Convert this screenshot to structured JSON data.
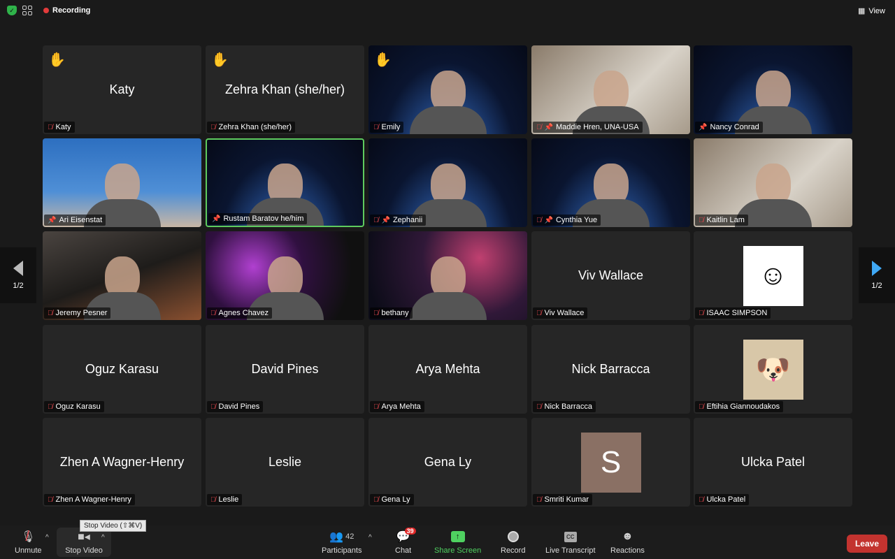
{
  "topbar": {
    "recording": "Recording",
    "view": "View"
  },
  "pager": {
    "left": "1/2",
    "right": "1/2"
  },
  "tiles": [
    {
      "name": "Katy",
      "center": "Katy",
      "hand": true,
      "muted": true
    },
    {
      "name": "Zehra Khan (she/her)",
      "center": "Zehra Khan (she/her)",
      "hand": true,
      "muted": true
    },
    {
      "name": "Emily",
      "hand": true,
      "muted": true,
      "video": "space"
    },
    {
      "name": "Maddie Hren, UNA-USA",
      "muted": true,
      "pinned": true,
      "video": "room"
    },
    {
      "name": "Nancy Conrad",
      "pinned": true,
      "video": "space"
    },
    {
      "name": "Ari Eisenstat",
      "pinned": true,
      "video": "blue"
    },
    {
      "name": "Rustam Baratov he/him",
      "pinned": true,
      "video": "space",
      "active": true
    },
    {
      "name": "Zephanii",
      "muted": true,
      "pinned": true,
      "video": "space"
    },
    {
      "name": "Cynthia Yue",
      "muted": true,
      "pinned": true,
      "video": "space"
    },
    {
      "name": "Kaitlin Lam",
      "muted": true,
      "video": "room"
    },
    {
      "name": "Jeremy Pesner",
      "muted": true,
      "video": "dark"
    },
    {
      "name": "Agnes Chavez",
      "muted": true,
      "video": "neon"
    },
    {
      "name": "bethany",
      "muted": true,
      "video": "nebula"
    },
    {
      "name": "Viv Wallace",
      "center": "Viv Wallace",
      "muted": true
    },
    {
      "name": "ISAAC SIMPSON",
      "muted": true,
      "avatar": "cartoon"
    },
    {
      "name": "Oguz Karasu",
      "center": "Oguz Karasu",
      "muted": true
    },
    {
      "name": "David Pines",
      "center": "David Pines",
      "muted": true
    },
    {
      "name": "Arya Mehta",
      "center": "Arya Mehta",
      "muted": true
    },
    {
      "name": "Nick Barracca",
      "center": "Nick Barracca",
      "muted": true
    },
    {
      "name": "Eftihia Giannoudakos",
      "muted": true,
      "avatar": "dog"
    },
    {
      "name": "Zhen A Wagner-Henry",
      "center": "Zhen A Wagner-Henry",
      "muted": true
    },
    {
      "name": "Leslie",
      "center": "Leslie",
      "muted": true
    },
    {
      "name": "Gena Ly",
      "center": "Gena Ly",
      "muted": true
    },
    {
      "name": "Smriti Kumar",
      "muted": true,
      "avatar": "letter",
      "letter": "S"
    },
    {
      "name": "Ulcka Patel",
      "center": "Ulcka Patel",
      "muted": true
    }
  ],
  "toolbar": {
    "unmute": "Unmute",
    "stop_video": "Stop Video",
    "tooltip": "Stop Video (⇧⌘V)",
    "participants": "Participants",
    "participant_count": "42",
    "chat": "Chat",
    "chat_badge": "39",
    "share": "Share Screen",
    "record": "Record",
    "transcript": "Live Transcript",
    "cc": "CC",
    "reactions": "Reactions",
    "leave": "Leave"
  },
  "colors": {
    "share": "#4fd160",
    "leave": "#c3332f",
    "active_border": "#5ecb5e",
    "recording": "#e23b3b"
  }
}
